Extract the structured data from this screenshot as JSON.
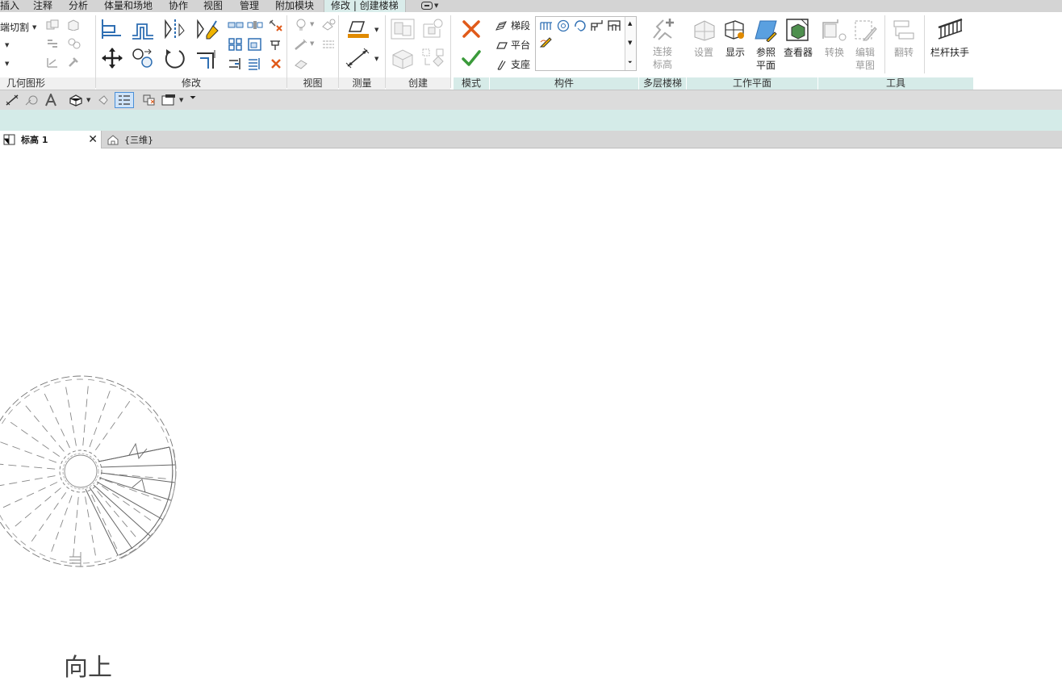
{
  "menu": {
    "tabs": [
      "插入",
      "注释",
      "分析",
      "体量和场地",
      "协作",
      "视图",
      "管理",
      "附加模块",
      "修改 | 创建楼梯"
    ],
    "active_tab": "修改 | 创建楼梯"
  },
  "ribbon": {
    "geometry": {
      "title": "几何图形",
      "cut_label": "端切割"
    },
    "modify": {
      "title": "修改"
    },
    "view": {
      "title": "视图"
    },
    "measure": {
      "title": "测量"
    },
    "create": {
      "title": "创建"
    },
    "mode": {
      "title": "模式"
    },
    "components": {
      "title": "构件",
      "run_label": "梯段",
      "landing_label": "平台",
      "support_label": "支座"
    },
    "multistory": {
      "title": "多层楼梯",
      "connect_levels_label": "连接\n标高"
    },
    "workplane": {
      "title": "工作平面",
      "set_label": "设置",
      "show_label": "显示",
      "ref_plane_label": "参照\n平面",
      "viewer_label": "查看器"
    },
    "tools": {
      "title": "工具",
      "convert_label": "转换",
      "edit_sketch_label": "编辑\n草图",
      "flip_label": "翻转",
      "railing_label": "栏杆扶手"
    }
  },
  "doc_tabs": [
    {
      "label": "标高 1",
      "active": true
    },
    {
      "label": "{三维}",
      "active": false
    }
  ],
  "canvas": {
    "stair_direction_label": "向上"
  },
  "colors": {
    "ribbon_context": "#d4ebe8",
    "cancel": "#e05a1a",
    "finish": "#3a9a3a",
    "accent_orange": "#e08a00",
    "accent_blue": "#2f6fb3"
  }
}
